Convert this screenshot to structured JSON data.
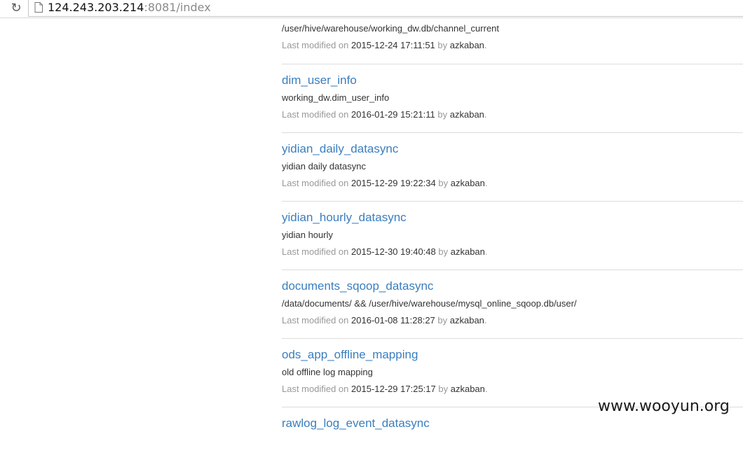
{
  "browser": {
    "url_host": "124.243.203.214",
    "url_rest": ":8081/index"
  },
  "first_item": {
    "description": "/user/hive/warehouse/working_dw.db/channel_current",
    "meta_prefix": "Last modified on",
    "modified": "2015-12-24 17:11:51",
    "by_label": "by",
    "user": "azkaban",
    "end": "."
  },
  "flows": [
    {
      "name": "dim_user_info",
      "description": "working_dw.dim_user_info",
      "meta_prefix": "Last modified on",
      "modified": "2016-01-29 15:21:11",
      "by_label": "by",
      "user": "azkaban",
      "end": "."
    },
    {
      "name": "yidian_daily_datasync",
      "description": "yidian daily datasync",
      "meta_prefix": "Last modified on",
      "modified": "2015-12-29 19:22:34",
      "by_label": "by",
      "user": "azkaban",
      "end": "."
    },
    {
      "name": "yidian_hourly_datasync",
      "description": "yidian hourly",
      "meta_prefix": "Last modified on",
      "modified": "2015-12-30 19:40:48",
      "by_label": "by",
      "user": "azkaban",
      "end": "."
    },
    {
      "name": "documents_sqoop_datasync",
      "description": "/data/documents/ && /user/hive/warehouse/mysql_online_sqoop.db/user/",
      "meta_prefix": "Last modified on",
      "modified": "2016-01-08 11:28:27",
      "by_label": "by",
      "user": "azkaban",
      "end": "."
    },
    {
      "name": "ods_app_offline_mapping",
      "description": "old offline log mapping",
      "meta_prefix": "Last modified on",
      "modified": "2015-12-29 17:25:17",
      "by_label": "by",
      "user": "azkaban",
      "end": "."
    },
    {
      "name": "rawlog_log_event_datasync",
      "description": "",
      "meta_prefix": "",
      "modified": "",
      "by_label": "",
      "user": "",
      "end": ""
    }
  ],
  "watermark": "www.wooyun.org",
  "colors": {
    "link": "#3a7ebf",
    "muted": "#999999",
    "text": "#333333",
    "divider": "#dcdcdc"
  },
  "icons": {
    "reload": "reload-icon",
    "page": "page-icon"
  }
}
